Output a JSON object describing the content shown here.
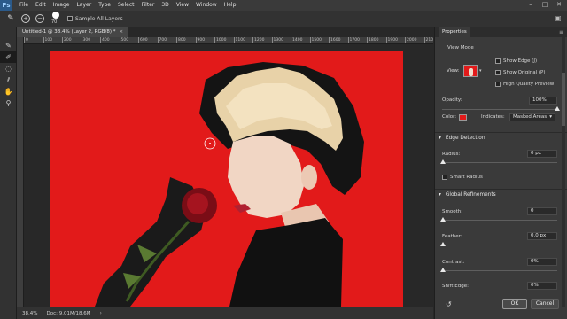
{
  "app": {
    "logo": "Ps"
  },
  "menu": [
    "File",
    "Edit",
    "Image",
    "Layer",
    "Type",
    "Select",
    "Filter",
    "3D",
    "View",
    "Window",
    "Help"
  ],
  "window_controls": {
    "minimize": "–",
    "maximize": "□",
    "close": "✕"
  },
  "options_bar": {
    "brush_size": "70",
    "sample_all_layers_label": "Sample All Layers",
    "sample_all_layers_checked": false
  },
  "document": {
    "tab_title": "Untitled-1 @ 38.4% (Layer 2, RGB/8) *",
    "tab_close": "×",
    "ruler_ticks": [
      "0",
      "100",
      "200",
      "300",
      "400",
      "500",
      "600",
      "700",
      "800",
      "900",
      "1000",
      "1100",
      "1200",
      "1300",
      "1400",
      "1500",
      "1600",
      "1700",
      "1800",
      "1900",
      "2000",
      "2100"
    ],
    "canvas_bg_color": "#e21a1a"
  },
  "status": {
    "zoom": "38.4%",
    "doc_info": "Doc: 9.01M/18.6M",
    "arrow": "›"
  },
  "tools": [
    "brush-icon",
    "refine-radius-icon",
    "quick-selection-icon",
    "lasso-icon",
    "hand-icon",
    "zoom-icon"
  ],
  "properties": {
    "tab_label": "Properties",
    "view_mode_label": "View Mode",
    "view_label": "View:",
    "show_edge_label": "Show Edge (J)",
    "show_original_label": "Show Original (P)",
    "high_quality_label": "High Quality Preview",
    "opacity_label": "Opacity:",
    "opacity_value": "100%",
    "opacity_fraction": 1.0,
    "color_label": "Color:",
    "color_value": "#e21a1a",
    "indicates_label": "Indicates:",
    "indicates_value": "Masked Areas",
    "edge_detection_label": "Edge Detection",
    "radius_label": "Radius:",
    "radius_value": "0 px",
    "smart_radius_label": "Smart Radius",
    "global_refinements_label": "Global Refinements",
    "smooth_label": "Smooth:",
    "smooth_value": "0",
    "feather_label": "Feather:",
    "feather_value": "0.0 px",
    "contrast_label": "Contrast:",
    "contrast_value": "0%",
    "shift_edge_label": "Shift Edge:",
    "shift_edge_value": "0%",
    "ok_label": "OK",
    "cancel_label": "Cancel"
  }
}
